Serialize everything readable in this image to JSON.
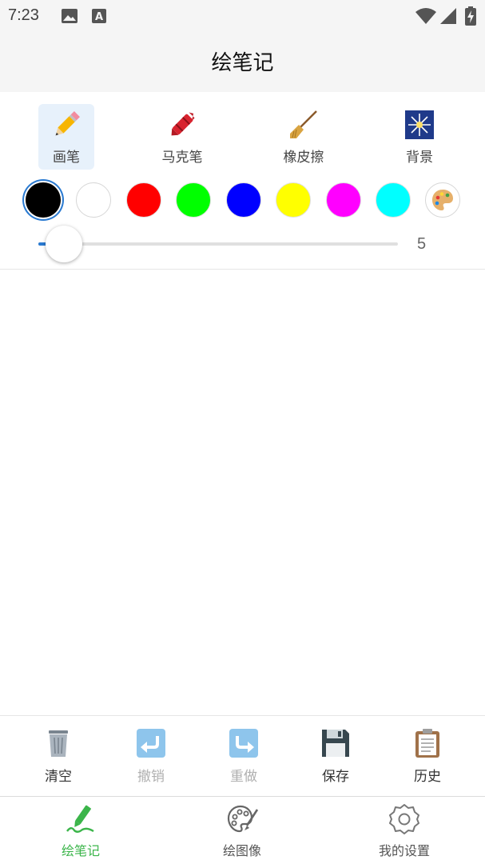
{
  "status": {
    "time": "7:23",
    "icons": [
      "image-icon",
      "text-a-icon",
      "wifi-icon",
      "signal-icon",
      "battery-icon"
    ]
  },
  "header": {
    "title": "绘笔记"
  },
  "tools": [
    {
      "label": "画笔",
      "icon": "pencil-icon",
      "active": true
    },
    {
      "label": "马克笔",
      "icon": "crayon-icon",
      "active": false
    },
    {
      "label": "橡皮擦",
      "icon": "broom-icon",
      "active": false
    },
    {
      "label": "背景",
      "icon": "sparkler-icon",
      "active": false
    }
  ],
  "palette": {
    "colors": [
      "#000000",
      "#ffffff",
      "#ff0000",
      "#00ff00",
      "#0000ff",
      "#ffff00",
      "#ff00ff",
      "#00ffff"
    ],
    "selected": "#000000",
    "custom_icon": "artist-palette-icon"
  },
  "brush_size": {
    "value": "5",
    "fraction": 0.07
  },
  "actions": [
    {
      "label": "清空",
      "icon": "trash-icon",
      "enabled": true
    },
    {
      "label": "撤销",
      "icon": "undo-icon",
      "enabled": false
    },
    {
      "label": "重做",
      "icon": "redo-icon",
      "enabled": false
    },
    {
      "label": "保存",
      "icon": "floppy-disk-icon",
      "enabled": true
    },
    {
      "label": "历史",
      "icon": "clipboard-icon",
      "enabled": true
    }
  ],
  "nav": [
    {
      "label": "绘笔记",
      "icon": "pen-sign-icon",
      "active": true
    },
    {
      "label": "绘图像",
      "icon": "palette-brush-icon",
      "active": false
    },
    {
      "label": "我的设置",
      "icon": "gear-icon",
      "active": false
    }
  ],
  "colors": {
    "accent": "#2a7ad1",
    "nav_active": "#3bb54a"
  }
}
